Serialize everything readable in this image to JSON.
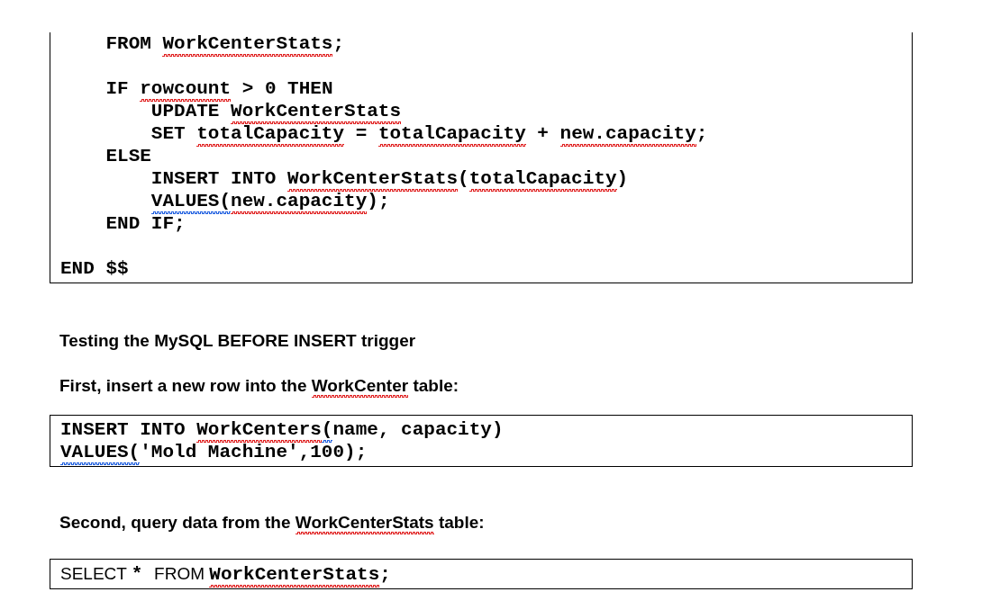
{
  "document": [
    {
      "kind": "code",
      "open_top": true,
      "lines": [
        {
          "space_before": false,
          "segments": [
            {
              "text": "    FROM "
            },
            {
              "text": "WorkCenterStats",
              "color": "#e02020"
            },
            {
              "text": ";"
            }
          ]
        },
        {
          "space_before": true,
          "segments": [
            {
              "text": "    IF "
            },
            {
              "text": "rowcount",
              "color": "#e02020"
            },
            {
              "text": " > 0 THEN"
            }
          ]
        },
        {
          "space_before": false,
          "segments": [
            {
              "text": "        UPDATE "
            },
            {
              "text": "WorkCenterStats",
              "color": "#e02020"
            }
          ]
        },
        {
          "space_before": false,
          "segments": [
            {
              "text": "        SET "
            },
            {
              "text": "totalCapacity",
              "color": "#e02020"
            },
            {
              "text": " = "
            },
            {
              "text": "totalCapacity",
              "color": "#e02020"
            },
            {
              "text": " + "
            },
            {
              "text": "new.capacity",
              "color": "#e02020"
            },
            {
              "text": ";"
            }
          ]
        },
        {
          "space_before": false,
          "segments": [
            {
              "text": "    ELSE"
            }
          ]
        },
        {
          "space_before": false,
          "segments": [
            {
              "text": "        INSERT INTO "
            },
            {
              "text": "WorkCenterStats",
              "color": "#e02020"
            },
            {
              "text": "("
            },
            {
              "text": "totalCapacity",
              "color": "#e02020"
            },
            {
              "text": ")"
            }
          ]
        },
        {
          "space_before": false,
          "segments": [
            {
              "text": "        VALUES(",
              "color": "#2060e0"
            },
            {
              "text": "new.capacity",
              "color": "#e02020"
            },
            {
              "text": ");"
            }
          ]
        },
        {
          "space_before": false,
          "segments": [
            {
              "text": "    END IF;"
            }
          ]
        },
        {
          "space_before": true,
          "segments": [
            {
              "text": "END $$"
            }
          ]
        }
      ]
    },
    {
      "kind": "heading",
      "segments": [
        {
          "text": "Testing the MySQL BEFORE INSERT trigger"
        }
      ]
    },
    {
      "kind": "heading",
      "segments": [
        {
          "text": "First, insert a new row into the "
        },
        {
          "text": "WorkCenter",
          "color": "#e02020"
        },
        {
          "text": " table:"
        }
      ]
    },
    {
      "kind": "code",
      "open_top": false,
      "lines": [
        {
          "space_before": false,
          "segments": [
            {
              "text": "INSERT INTO "
            },
            {
              "text": "WorkCenters",
              "color": "#e02020"
            },
            {
              "text": "(",
              "color": "#2060e0"
            },
            {
              "text": "name, capacity)"
            }
          ]
        },
        {
          "space_before": false,
          "segments": [
            {
              "text": "VALUES(",
              "color": "#2060e0"
            },
            {
              "text": "'Mold Machine',100);"
            }
          ]
        }
      ]
    },
    {
      "kind": "heading",
      "segments": [
        {
          "text": "Second, query data from the "
        },
        {
          "text": "WorkCenterStats",
          "color": "#e02020"
        },
        {
          "text": " table:"
        }
      ]
    },
    {
      "kind": "code",
      "open_top": false,
      "lines": [
        {
          "space_before": false,
          "segments": [
            {
              "text": "SELECT ",
              "kind": "sans"
            },
            {
              "text": "* ",
              "kind": "mono"
            },
            {
              "text": "FROM ",
              "kind": "sans"
            },
            {
              "text": "WorkCenterStats",
              "color": "#e02020",
              "kind": "mono"
            },
            {
              "text": ";",
              "kind": "mono"
            }
          ]
        }
      ]
    }
  ]
}
